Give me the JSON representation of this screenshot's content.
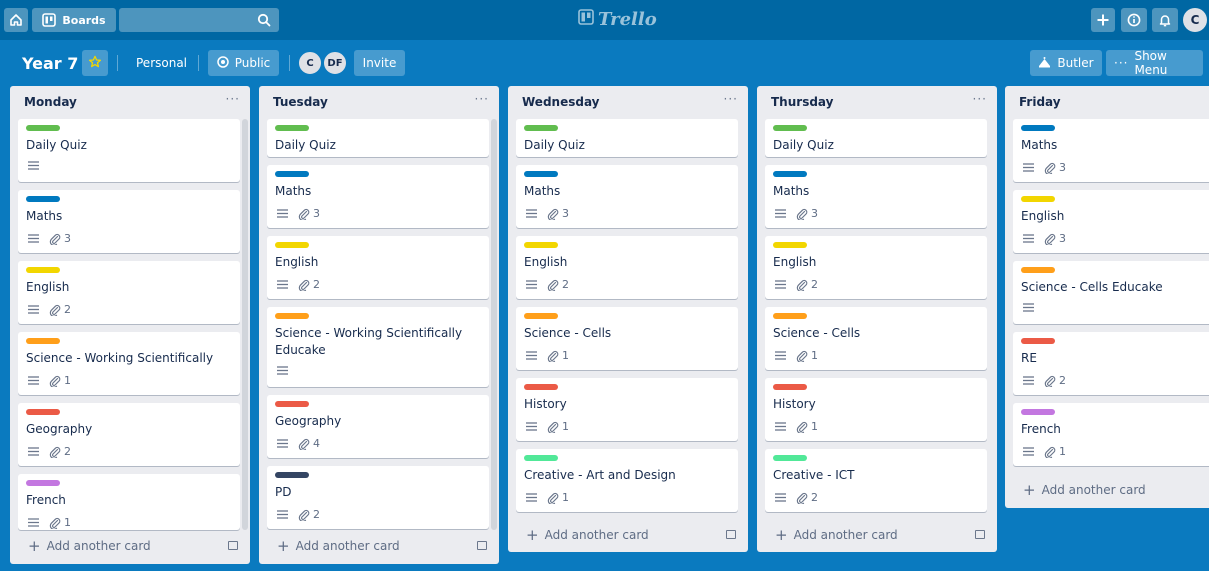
{
  "header": {
    "boards_label": "Boards",
    "logo_text": "Trello",
    "user_initial": "C"
  },
  "board": {
    "title": "Year 7",
    "team_label": "Personal",
    "visibility_label": "Public",
    "members": [
      "C",
      "DF"
    ],
    "invite_label": "Invite",
    "butler_label": "Butler",
    "menu_label": "Show Menu"
  },
  "colors": {
    "green": "#61bd4f",
    "blue": "#0079bf",
    "yellow": "#f2d600",
    "orange": "#ff9f1a",
    "red": "#eb5a46",
    "purple": "#c377e0",
    "navy": "#344563",
    "lime": "#51e898"
  },
  "add_card_label": "Add another card",
  "lists": [
    {
      "title": "Monday",
      "cards": [
        {
          "title": "Daily Quiz",
          "label": "green",
          "attachments": null
        },
        {
          "title": "Maths",
          "label": "blue",
          "attachments": "3"
        },
        {
          "title": "English",
          "label": "yellow",
          "attachments": "2"
        },
        {
          "title": "Science - Working Scientifically",
          "label": "orange",
          "attachments": "1"
        },
        {
          "title": "Geography",
          "label": "red",
          "attachments": "2"
        },
        {
          "title": "French",
          "label": "purple",
          "attachments": "1"
        }
      ]
    },
    {
      "title": "Tuesday",
      "cards": [
        {
          "title": "Daily Quiz",
          "label": "green",
          "attachments": null
        },
        {
          "title": "Maths",
          "label": "blue",
          "attachments": "3"
        },
        {
          "title": "English",
          "label": "yellow",
          "attachments": "2"
        },
        {
          "title": "Science - Working Scientifically Educake",
          "label": "orange",
          "attachments": null
        },
        {
          "title": "Geography",
          "label": "red",
          "attachments": "4"
        },
        {
          "title": "PD",
          "label": "navy",
          "attachments": "2"
        }
      ]
    },
    {
      "title": "Wednesday",
      "cards": [
        {
          "title": "Daily Quiz",
          "label": "green",
          "attachments": null
        },
        {
          "title": "Maths",
          "label": "blue",
          "attachments": "3"
        },
        {
          "title": "English",
          "label": "yellow",
          "attachments": "2"
        },
        {
          "title": "Science - Cells",
          "label": "orange",
          "attachments": "1"
        },
        {
          "title": "History",
          "label": "red",
          "attachments": "1"
        },
        {
          "title": "Creative - Art and Design",
          "label": "lime",
          "attachments": "1"
        }
      ]
    },
    {
      "title": "Thursday",
      "cards": [
        {
          "title": "Daily Quiz",
          "label": "green",
          "attachments": null
        },
        {
          "title": "Maths",
          "label": "blue",
          "attachments": "3"
        },
        {
          "title": "English",
          "label": "yellow",
          "attachments": "2"
        },
        {
          "title": "Science - Cells",
          "label": "orange",
          "attachments": "1"
        },
        {
          "title": "History",
          "label": "red",
          "attachments": "1"
        },
        {
          "title": "Creative - ICT",
          "label": "lime",
          "attachments": "2"
        }
      ]
    },
    {
      "title": "Friday",
      "cards": [
        {
          "title": "Maths",
          "label": "blue",
          "attachments": "3"
        },
        {
          "title": "English",
          "label": "yellow",
          "attachments": "3"
        },
        {
          "title": "Science - Cells Educake",
          "label": "orange",
          "attachments": null
        },
        {
          "title": "RE",
          "label": "red",
          "attachments": "2"
        },
        {
          "title": "French",
          "label": "purple",
          "attachments": "1"
        }
      ]
    }
  ]
}
